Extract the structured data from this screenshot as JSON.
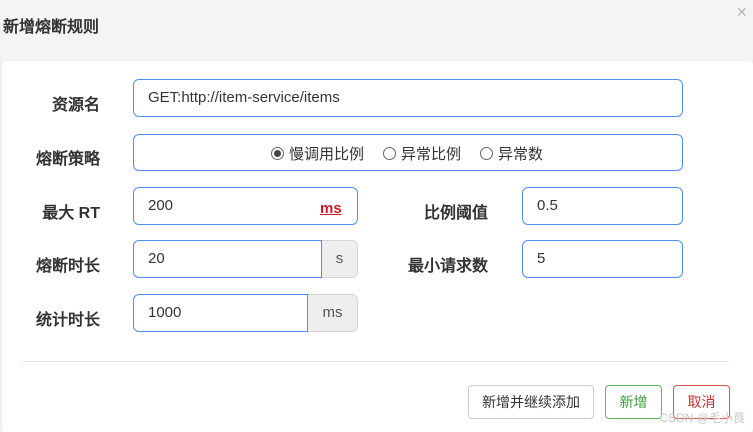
{
  "dialog": {
    "title": "新增熔断规则",
    "close_symbol": "×"
  },
  "form": {
    "resource_label": "资源名",
    "resource_value": "GET:http://item-service/items",
    "strategy_label": "熔断策略",
    "strategy_options": [
      {
        "label": "慢调用比例",
        "checked": true
      },
      {
        "label": "异常比例",
        "checked": false
      },
      {
        "label": "异常数",
        "checked": false
      }
    ],
    "max_rt_label": "最大 RT",
    "max_rt_value": "200",
    "max_rt_unit": "ms",
    "ratio_threshold_label": "比例阈值",
    "ratio_threshold_value": "0.5",
    "break_duration_label": "熔断时长",
    "break_duration_value": "20",
    "break_duration_unit": "s",
    "min_requests_label": "最小请求数",
    "min_requests_value": "5",
    "stat_duration_label": "统计时长",
    "stat_duration_value": "1000",
    "stat_duration_unit": "ms"
  },
  "footer": {
    "add_continue_label": "新增并继续添加",
    "add_label": "新增",
    "cancel_label": "取消"
  },
  "watermark": "CSDN @毛小茛",
  "colors": {
    "field_border": "#4f8ff5",
    "unit_red": "#d01c2a",
    "success": "#5cb85c",
    "danger": "#d9534f"
  }
}
